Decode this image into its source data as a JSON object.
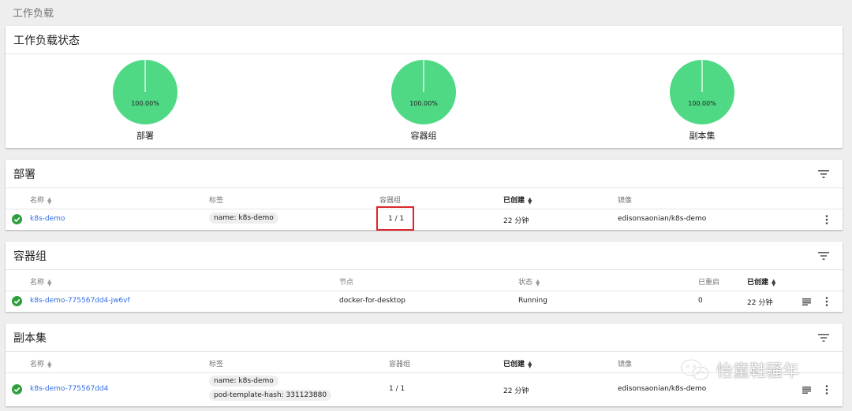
{
  "page": {
    "title": "工作负载"
  },
  "status": {
    "title": "工作负载状态",
    "pies": [
      {
        "label": "部署",
        "percent": "100.00%",
        "value": 100,
        "color": "#4fd985"
      },
      {
        "label": "容器组",
        "percent": "100.00%",
        "value": 100,
        "color": "#4fd985"
      },
      {
        "label": "副本集",
        "percent": "100.00%",
        "value": 100,
        "color": "#4fd985"
      }
    ]
  },
  "deployments": {
    "title": "部署",
    "columns": {
      "name": "名称",
      "labels": "标签",
      "pods": "容器组",
      "created": "已创建",
      "images": "镜像"
    },
    "rows": [
      {
        "name": "k8s-demo",
        "labels": [
          "name: k8s-demo"
        ],
        "pods": "1 / 1",
        "created": "22 分钟",
        "image": "edisonsaonian/k8s-demo"
      }
    ]
  },
  "pods": {
    "title": "容器组",
    "columns": {
      "name": "名称",
      "node": "节点",
      "status": "状态",
      "restarts": "已重启",
      "created": "已创建"
    },
    "rows": [
      {
        "name": "k8s-demo-775567dd4-jw6vf",
        "node": "docker-for-desktop",
        "status": "Running",
        "restarts": "0",
        "created": "22 分钟"
      }
    ]
  },
  "replicasets": {
    "title": "副本集",
    "columns": {
      "name": "名称",
      "labels": "标签",
      "pods": "容器组",
      "created": "已创建",
      "images": "镜像"
    },
    "rows": [
      {
        "name": "k8s-demo-775567dd4",
        "labels": [
          "name: k8s-demo",
          "pod-template-hash: 331123880"
        ],
        "pods": "1 / 1",
        "created": "22 分钟",
        "image": "edisonsaonian/k8s-demo"
      }
    ]
  },
  "watermark": {
    "text": "怡童鞋骚年"
  },
  "colors": {
    "accent": "#326de6",
    "success": "#2e9e3e",
    "highlight": "#d9262b"
  }
}
